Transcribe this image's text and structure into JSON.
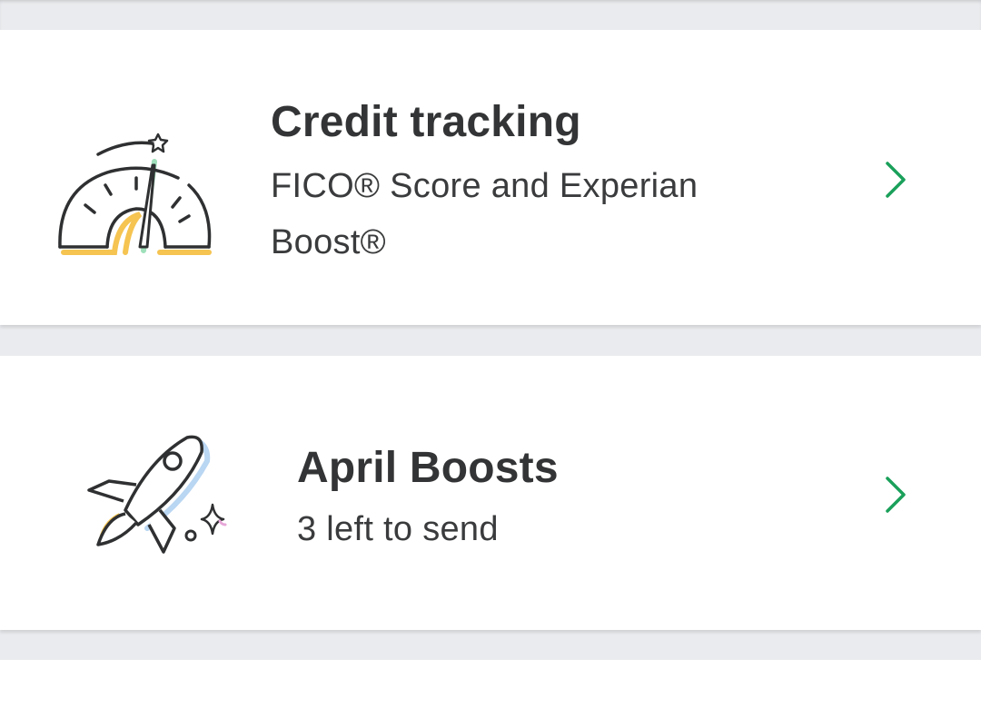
{
  "colors": {
    "accent_green": "#1aa05a",
    "title_text": "#333435",
    "background": "#e9ebee",
    "card": "#ffffff"
  },
  "cards": [
    {
      "icon": "speedometer-icon",
      "title": "Credit tracking",
      "subtitle": "FICO® Score and Experian Boost®",
      "chevron": "chevron-right-icon"
    },
    {
      "icon": "rocket-icon",
      "title": "April Boosts",
      "subtitle": "3 left to send",
      "chevron": "chevron-right-icon"
    }
  ]
}
